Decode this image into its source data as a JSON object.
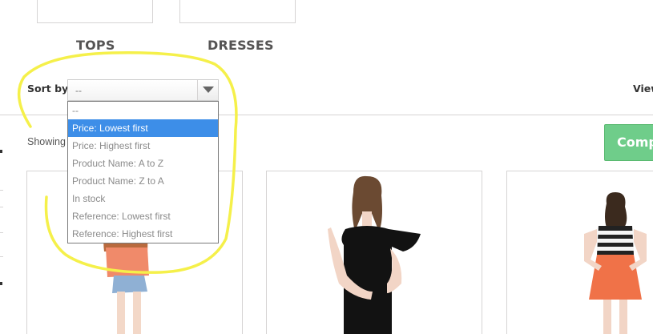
{
  "categories": [
    {
      "label": "TOPS"
    },
    {
      "label": "DRESSES"
    }
  ],
  "sort": {
    "label": "Sort by",
    "selected_value": "--",
    "options": [
      {
        "label": "--",
        "selected": false
      },
      {
        "label": "Price: Lowest first",
        "selected": true
      },
      {
        "label": "Price: Highest first",
        "selected": false
      },
      {
        "label": "Product Name: A to Z",
        "selected": false
      },
      {
        "label": "Product Name: Z to A",
        "selected": false
      },
      {
        "label": "In stock",
        "selected": false
      },
      {
        "label": "Reference: Lowest first",
        "selected": false
      },
      {
        "label": "Reference: Highest first",
        "selected": false
      }
    ]
  },
  "view": {
    "label": "View"
  },
  "listing": {
    "showing_text": "Showing"
  },
  "compare": {
    "label": "Compare"
  },
  "colors": {
    "highlight": "#3d8ee8",
    "compare_button": "#6fcd8a",
    "annotation": "#f5f04a"
  },
  "icons": {
    "dropdown_arrow": "chevron-down-icon"
  }
}
